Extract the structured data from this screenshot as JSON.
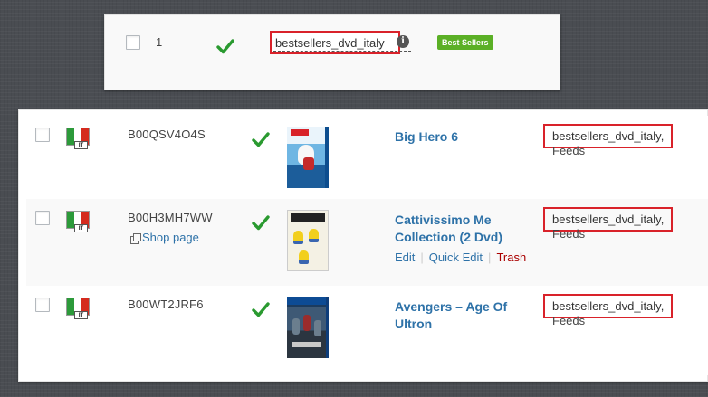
{
  "top_row": {
    "number": "1",
    "term": "bestsellers_dvd_italy",
    "info_glyph": "i",
    "badge": "Best Sellers",
    "badge_color": "#5bb026"
  },
  "colors": {
    "link": "#2e72a8",
    "check": "#2a9a30",
    "highlight_box": "#d9222a",
    "trash": "#aa0000"
  },
  "rows": [
    {
      "flag_label": "IT",
      "asin": "B00QSV4O4S",
      "title": "Big Hero 6",
      "terms": "bestsellers_dvd_italy,",
      "feeds": "Feeds"
    },
    {
      "flag_label": "IT",
      "asin": "B00H3MH7WW",
      "shop_link": "Shop page",
      "title": "Cattivissimo Me Collection (2 Dvd)",
      "actions": {
        "edit": "Edit",
        "quick_edit": "Quick Edit",
        "trash": "Trash",
        "separator": "|"
      },
      "terms": "bestsellers_dvd_italy,",
      "feeds": "Feeds"
    },
    {
      "flag_label": "IT",
      "asin": "B00WT2JRF6",
      "title": "Avengers – Age Of Ultron",
      "terms": "bestsellers_dvd_italy,",
      "feeds": "Feeds"
    }
  ],
  "icons": {
    "check": "checkmark-icon",
    "flag": "italy-flag-icon",
    "external": "external-link-icon",
    "info": "info-icon"
  }
}
